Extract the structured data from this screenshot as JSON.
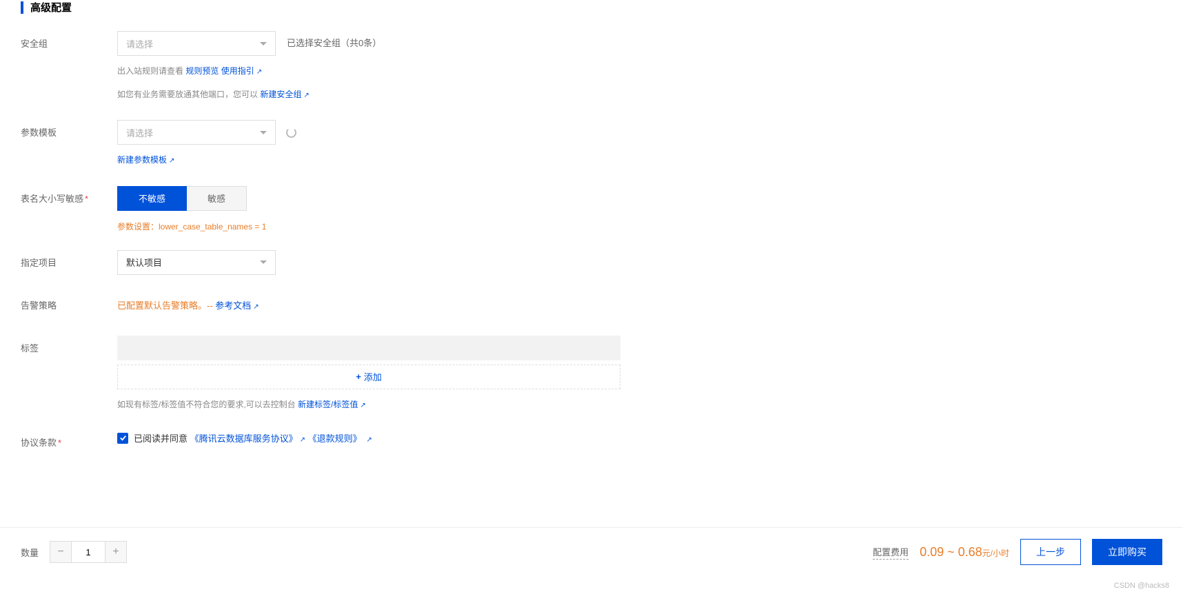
{
  "section": {
    "title": "高级配置"
  },
  "form": {
    "security_group": {
      "label": "安全组",
      "placeholder": "请选择",
      "selected_text": "已选择安全组（共0条）",
      "hint1_prefix": "出入站规则请查看 ",
      "link_rule_preview": "规则预览",
      "link_usage_guide": "使用指引",
      "hint2_prefix": "如您有业务需要放通其他端口，您可以 ",
      "link_new_sg": "新建安全组"
    },
    "param_template": {
      "label": "参数模板",
      "placeholder": "请选择",
      "link_new_template": "新建参数模板"
    },
    "case_sensitive": {
      "label": "表名大小写敏感",
      "opt_insensitive": "不敏感",
      "opt_sensitive": "敏感",
      "param_note": "参数设置：lower_case_table_names = 1"
    },
    "project": {
      "label": "指定项目",
      "value": "默认项目"
    },
    "alarm_policy": {
      "label": "告警策略",
      "prefix": "已配置默认告警策略。-- ",
      "link_doc": "参考文档"
    },
    "tags": {
      "label": "标签",
      "add_label": "添加",
      "hint_prefix": "如现有标签/标签值不符合您的要求,可以去控制台 ",
      "link_new_tag": "新建标签/标签值"
    },
    "agreement": {
      "label": "协议条款",
      "read_prefix": "已阅读并同意",
      "link_service": "《腾讯云数据库服务协议》",
      "link_refund": "《退款规则》"
    }
  },
  "footer": {
    "qty_label": "数量",
    "qty_value": "1",
    "price_label": "配置费用",
    "price_value": "0.09 ~ 0.68",
    "price_unit": "元/小时",
    "btn_prev": "上一步",
    "btn_buy": "立即购买"
  },
  "watermark": "CSDN @hacks8"
}
